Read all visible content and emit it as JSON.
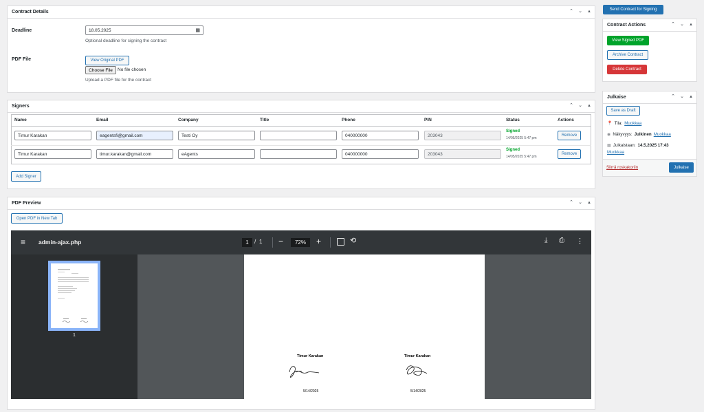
{
  "contract_details": {
    "title": "Contract Details",
    "deadline_label": "Deadline",
    "deadline_value": "18.05.2025",
    "deadline_desc": "Optional deadline for signing the contract",
    "pdf_label": "PDF File",
    "view_original": "View Original PDF",
    "choose_file": "Choose File",
    "no_file": "No file chosen",
    "pdf_desc": "Upload a PDF file for the contract"
  },
  "signers": {
    "title": "Signers",
    "headers": [
      "Name",
      "Email",
      "Company",
      "Title",
      "Phone",
      "PIN",
      "Status",
      "Actions"
    ],
    "rows": [
      {
        "name": "Timur Karakan",
        "email": "eagentsfi@gmail.com",
        "company": "Testi Oy",
        "title": "",
        "phone": "040000000",
        "pin": "203043",
        "status": "Signed",
        "time": "14/05/2025 5:47 pm",
        "action": "Remove"
      },
      {
        "name": "Timur Karakan",
        "email": "timur.karakan@gmail.com",
        "company": "eAgents",
        "title": "",
        "phone": "040000000",
        "pin": "203043",
        "status": "Signed",
        "time": "14/05/2025 5:47 pm",
        "action": "Remove"
      }
    ],
    "add_signer": "Add Signer"
  },
  "pdf_preview": {
    "title": "PDF Preview",
    "open_new_tab": "Open PDF in New Tab",
    "viewer": {
      "filename": "admin-ajax.php",
      "page_current": "1",
      "page_sep": "/",
      "page_total": "1",
      "zoom": "72%",
      "thumb_label": "1",
      "sig1_name": "Timur Karakan",
      "sig1_date": "5/14/2025",
      "sig2_name": "Timur Karakan",
      "sig2_date": "5/14/2025"
    }
  },
  "sidebar": {
    "send_button": "Send Contract for Signing",
    "actions_title": "Contract Actions",
    "view_signed": "View Signed PDF",
    "archive": "Archive Contract",
    "delete": "Delete Contract",
    "publish_title": "Julkaise",
    "save_draft": "Save as Draft",
    "status_label": "Tila:",
    "status_edit": "Muokkaa",
    "visibility_label": "Näkyvyys:",
    "visibility_value": "Julkinen",
    "visibility_edit": "Muokkaa",
    "published_label": "Julkaistaan:",
    "published_value": "14.5.2025 17:43",
    "published_edit": "Muokkaa",
    "trash": "Siirrä roskakoriin",
    "publish_button": "Julkaise"
  },
  "colors": {
    "primary": "#2271b1",
    "success": "#00a32a",
    "danger": "#d63638",
    "viewer_bar": "#323639"
  }
}
